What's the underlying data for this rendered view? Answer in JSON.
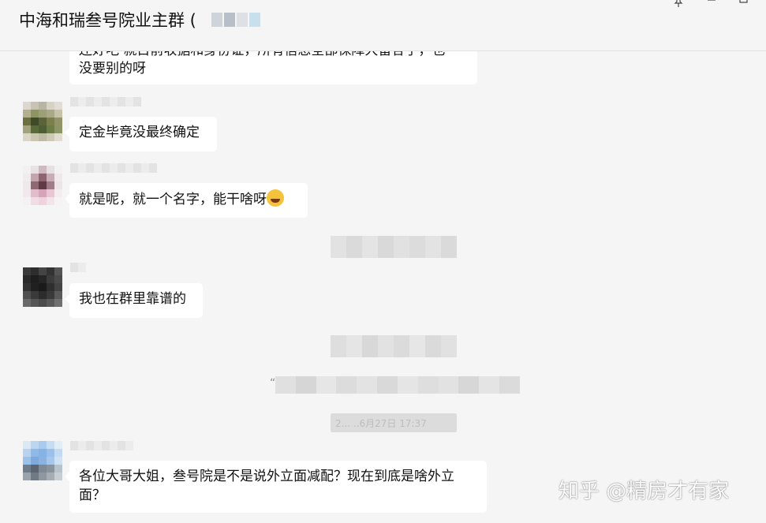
{
  "header": {
    "title": "中海和瑞叁号院业主群 (",
    "pin_icon": "pin-icon",
    "minimize_icon": "minimize-icon",
    "maximize_icon": "maximize-icon"
  },
  "messages": [
    {
      "text": "没要别的呀",
      "partial_top_text": "还好吧 就目前收据和身份证，所有信息全部保障大留各子，也"
    },
    {
      "text": "定金毕竟没最终确定"
    },
    {
      "text": "就是呢，就一个名字，能干啥呀",
      "emoji": "grinning-sweat-emoji"
    },
    {
      "text": "我也在群里靠谱的"
    },
    {
      "text": "各位大哥大姐，叁号院是不是说外立面减配？现在到底是啥外立面？"
    }
  ],
  "system": {
    "quote_mark": "“",
    "timestamp": "2...  ..6月27日 17:37"
  },
  "watermark": {
    "text": "知乎 @精房才有家"
  },
  "colors": {
    "background": "#f5f5f5",
    "bubble": "#ffffff",
    "text": "#111111"
  }
}
